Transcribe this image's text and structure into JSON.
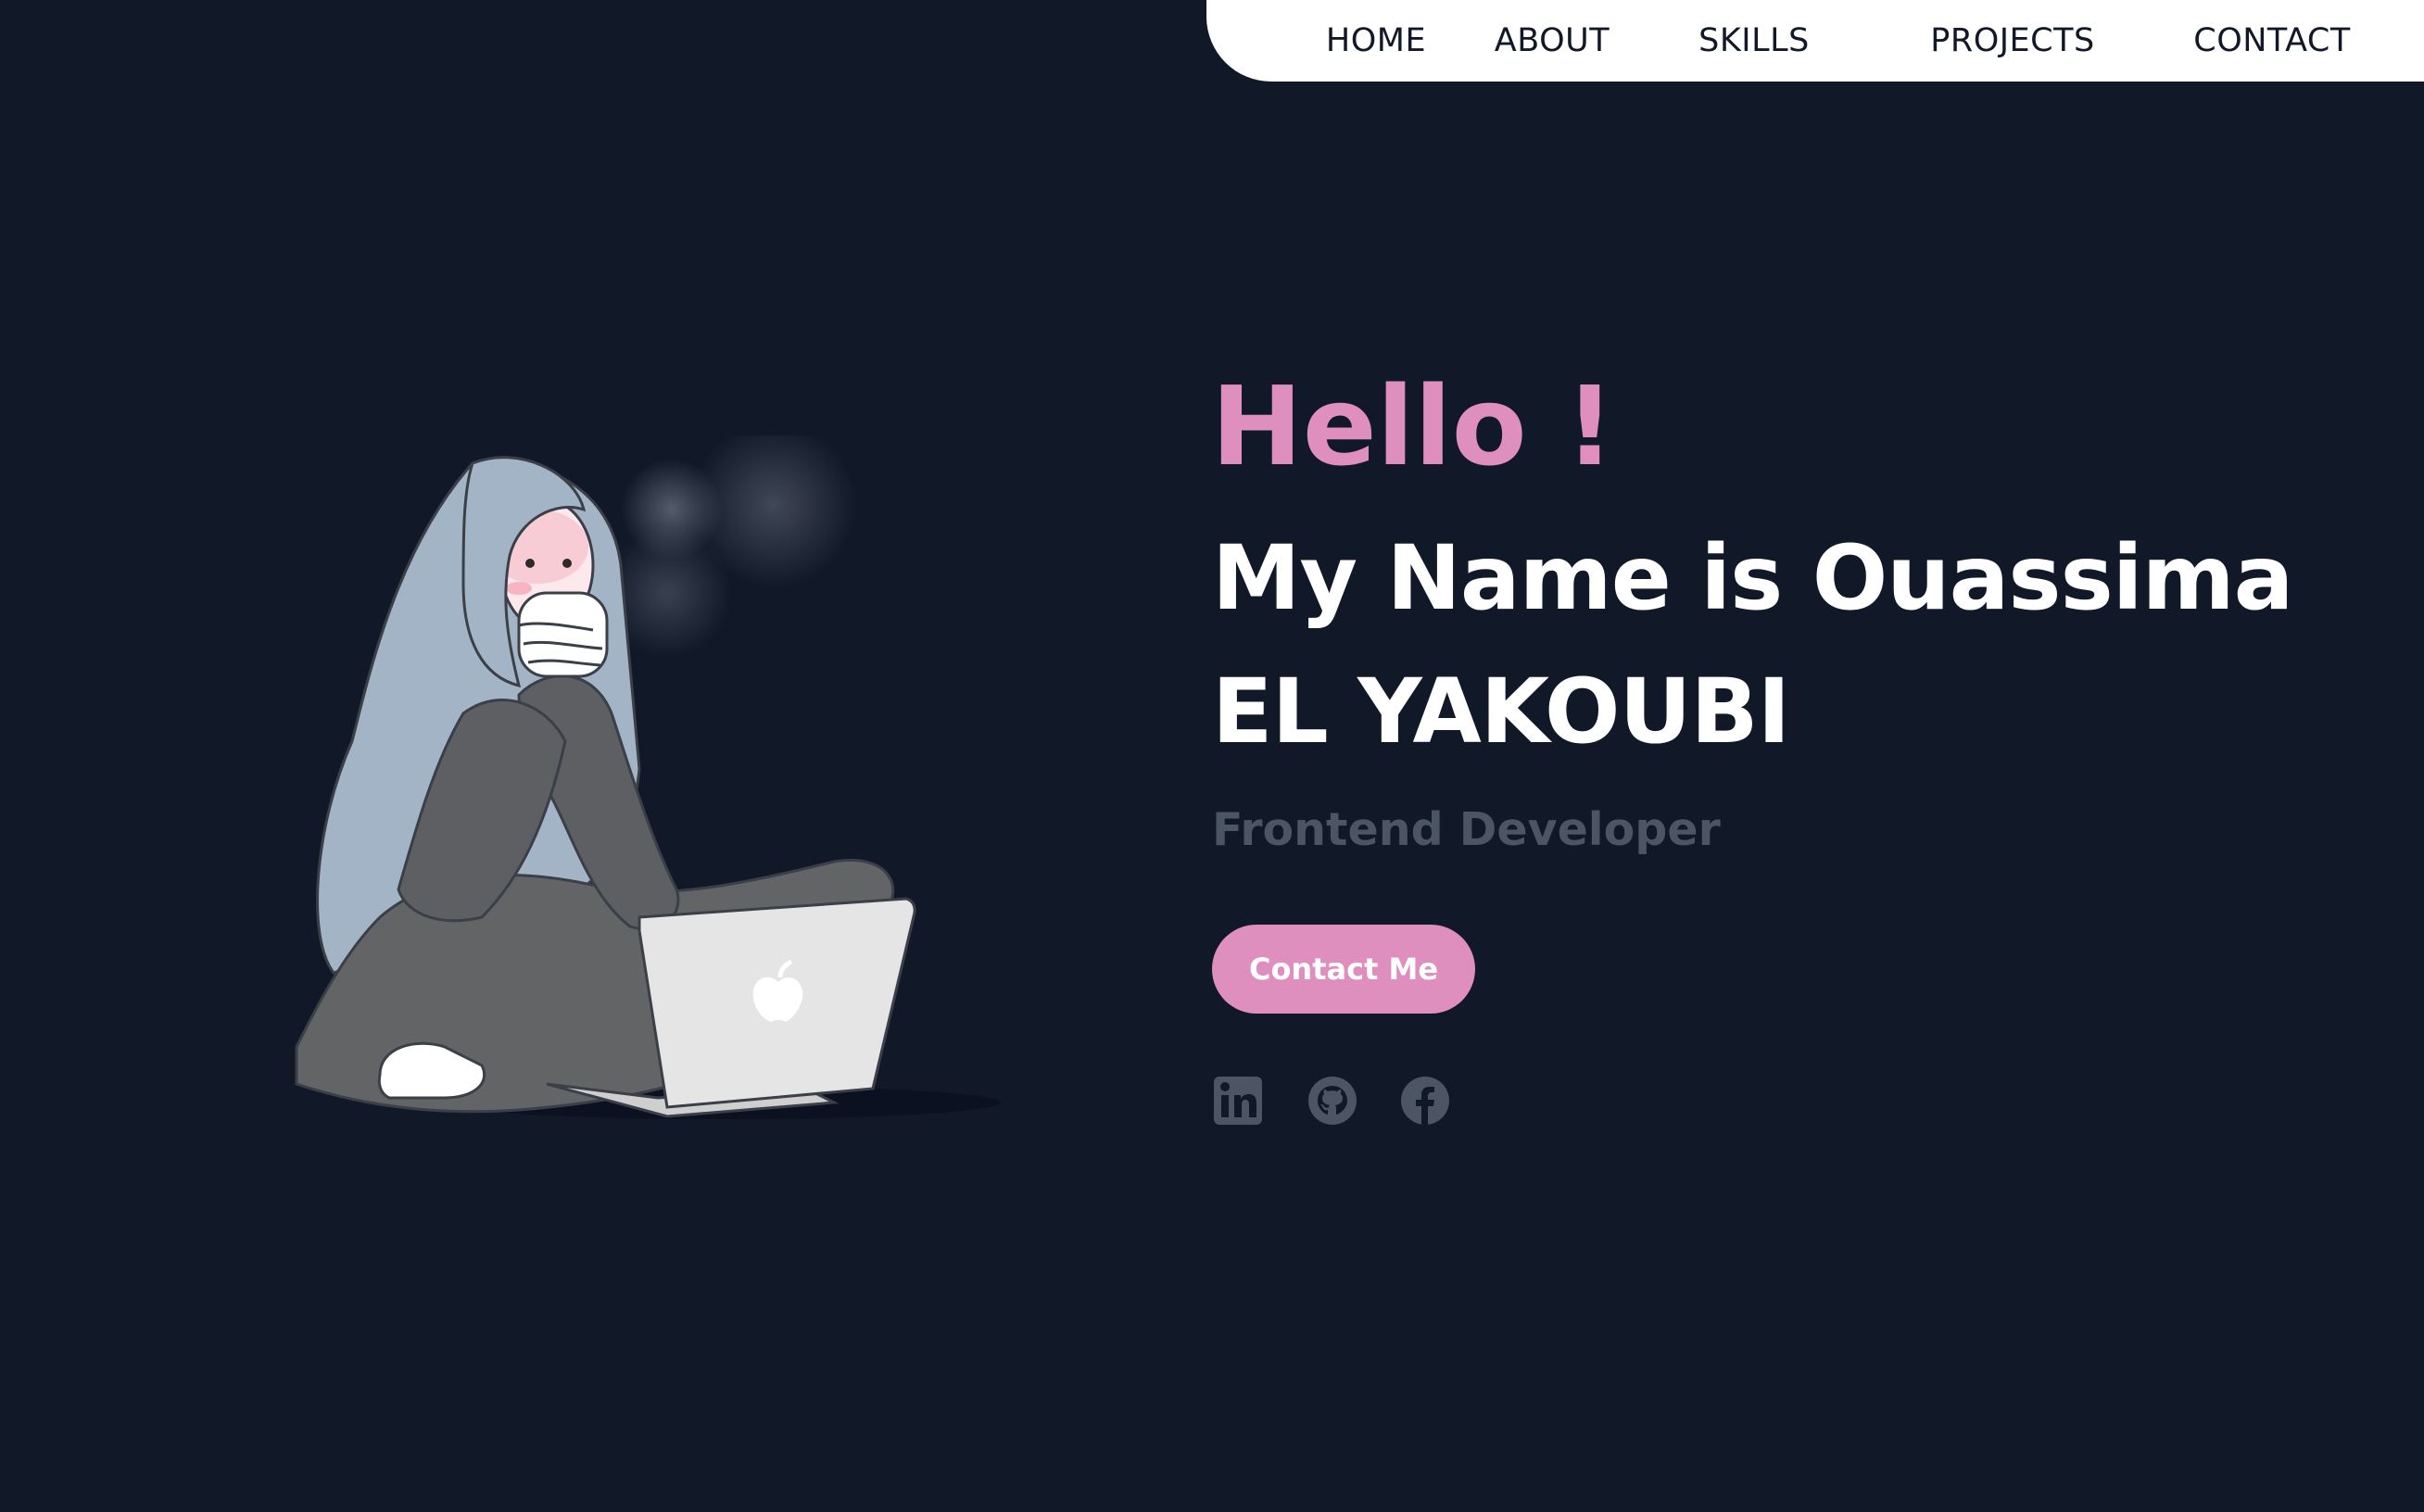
{
  "nav": {
    "items": [
      {
        "label": "HOME"
      },
      {
        "label": "ABOUT"
      },
      {
        "label": "SKILLS"
      },
      {
        "label": "PROJECTS"
      },
      {
        "label": "CONTACT"
      }
    ]
  },
  "hero": {
    "greeting": "Hello !",
    "name": "My Name is Ouassima EL YAKOUBI",
    "role": "Frontend Developer",
    "cta_label": "Contact Me"
  },
  "social": [
    {
      "icon": "linkedin-icon"
    },
    {
      "icon": "github-icon"
    },
    {
      "icon": "facebook-icon"
    }
  ],
  "colors": {
    "background": "#111827",
    "accent": "#df8fbd",
    "nav_bg": "#ffffff",
    "muted": "#4b5563"
  }
}
